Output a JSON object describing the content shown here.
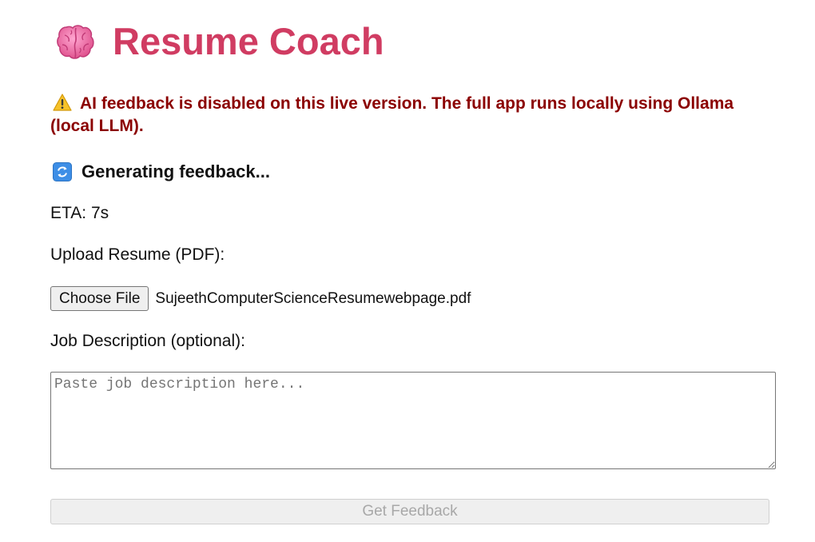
{
  "header": {
    "icon": "brain-icon",
    "title": "Resume Coach",
    "title_color": "#d03c62"
  },
  "warning": {
    "icon": "warning-icon",
    "text": "AI feedback is disabled on this live version. The full app runs locally using Ollama (local LLM).",
    "color": "#8b0000"
  },
  "status": {
    "icon": "refresh-icon",
    "text": "Generating feedback...",
    "eta": "ETA: 7s"
  },
  "upload": {
    "label": "Upload Resume (PDF):",
    "button_label": "Choose File",
    "file_name": "SujeethComputerScienceResumewebpage.pdf"
  },
  "job_description": {
    "label": "Job Description (optional):",
    "value": "",
    "placeholder": "Paste job description here..."
  },
  "submit": {
    "label": "Get Feedback",
    "disabled": true
  }
}
